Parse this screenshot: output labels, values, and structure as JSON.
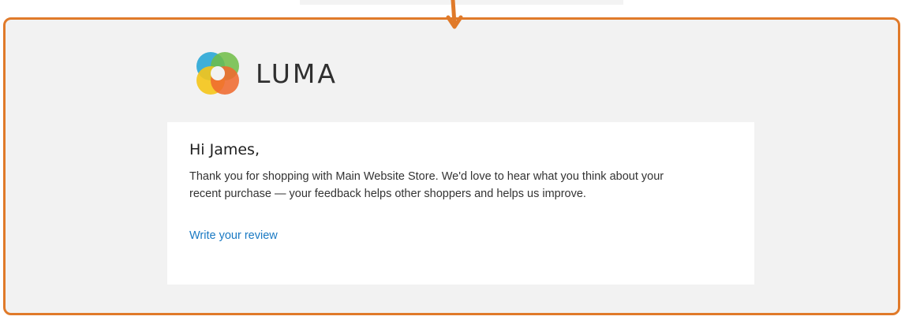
{
  "email": {
    "brand_name": "LUMA",
    "greeting": "Hi James,",
    "body_line1": "Thank you for shopping with Main Website Store. We'd love to hear what you think about your",
    "body_line2": "recent purchase — your feedback helps other shoppers and helps us improve.",
    "review_link": "Write your review"
  },
  "colors": {
    "frame_border": "#e07a2a",
    "link": "#1979c3",
    "background": "#f2f2f2",
    "card": "#ffffff"
  },
  "icons": {
    "arrow": "arrow-down-icon",
    "logo": "luma-logo-icon"
  }
}
